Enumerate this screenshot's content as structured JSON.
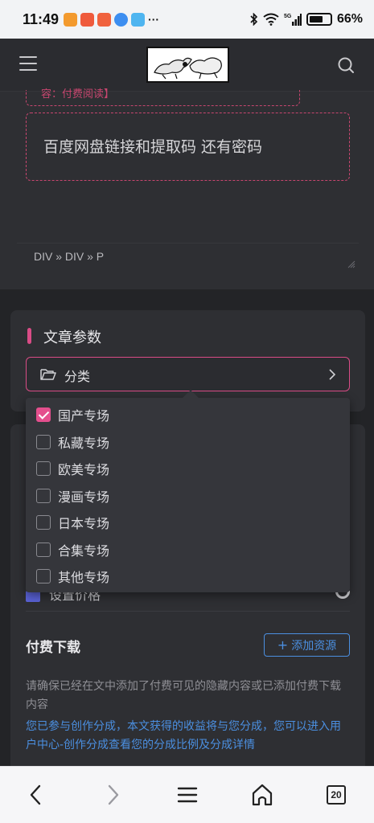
{
  "status_bar": {
    "time": "11:49",
    "more": "···",
    "battery": "66%",
    "battery_level": 0.66,
    "network": "5G"
  },
  "header": {
    "menu_icon": "hamburger-icon",
    "logo_icon": "site-logo-illustration",
    "search_icon": "search-icon"
  },
  "article": {
    "hidden_content_top_fragment": "容：付费阅读】",
    "hidden_content_text": "百度网盘链接和提取码  还有密码",
    "path": "DIV » DIV » P"
  },
  "article_params": {
    "title": "文章参数",
    "category_label": "分类",
    "category_options": [
      {
        "label": "国产专场",
        "checked": true
      },
      {
        "label": "私藏专场",
        "checked": false
      },
      {
        "label": "欧美专场",
        "checked": false
      },
      {
        "label": "漫画专场",
        "checked": false
      },
      {
        "label": "日本专场",
        "checked": false
      },
      {
        "label": "合集专场",
        "checked": false
      },
      {
        "label": "其他专场",
        "checked": false
      }
    ]
  },
  "price": {
    "label": "设置价格"
  },
  "paid_download": {
    "title": "付费下载",
    "add_button": "添加资源",
    "note": "请确保已经在文中添加了付费可见的隐藏内容或已添加付费下载内容",
    "split_note": "您已参与创作分成，本文获得的收益将与您分成，您可以进入用户中心-创作分成查看您的分成比例及分成详情"
  },
  "bottom_nav": {
    "tab_count": "20"
  },
  "colors": {
    "accent_pink": "#d94c86",
    "accent_blue": "#4b8fe0",
    "bg_dark": "#2b2c30"
  }
}
